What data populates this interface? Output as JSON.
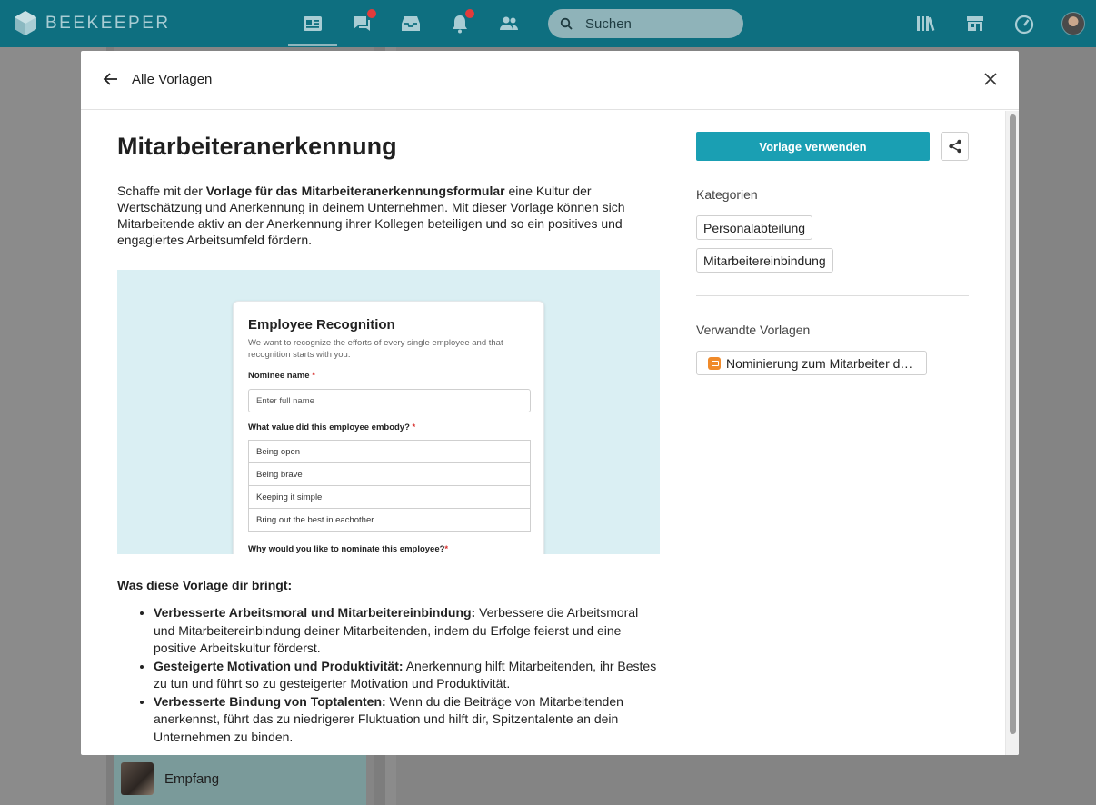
{
  "app": {
    "name": "BEEKEEPER"
  },
  "search": {
    "placeholder": "Suchen"
  },
  "sidebar_bg": {
    "item_label": "Empfang"
  },
  "modal": {
    "back_label": "Alle Vorlagen",
    "title": "Mitarbeiteranerkennung",
    "intro": {
      "before": "Schaffe mit der ",
      "bold": "Vorlage für das Mitarbeiteranerkennungsformular",
      "after": " eine Kultur der Wertschätzung und Anerkennung in deinem Unternehmen. Mit dieser Vorlage können sich Mitarbeitende aktiv an der Anerkennung ihrer Kollegen beteiligen und so ein positives und engagiertes Arbeitsumfeld fördern."
    },
    "preview": {
      "title": "Employee Recognition",
      "description": "We want to recognize the efforts of every single employee and that recognition starts with you.",
      "field1_label": "Nominee name",
      "field1_placeholder": "Enter full name",
      "field2_label": "What value did this employee embody?",
      "options": [
        "Being open",
        "Being brave",
        "Keeping it simple",
        "Bring out the best in eachother"
      ],
      "field3_label": "Why would you like to nominate this employee?",
      "required_mark": "*"
    },
    "benefits_heading": "Was diese Vorlage dir bringt:",
    "benefits": [
      {
        "title": "Verbesserte Arbeitsmoral und Mitarbeitereinbindung:",
        "text": " Verbessere die Arbeitsmoral und Mitarbeitereinbindung deiner Mitarbeitenden, indem du Erfolge feierst und eine positive Arbeitskultur förderst."
      },
      {
        "title": "Gesteigerte Motivation und Produktivität:",
        "text": " Anerkennung hilft Mitarbeitenden, ihr Bestes zu tun und führt so zu gesteigerter Motivation und Produktivität."
      },
      {
        "title": "Verbesserte Bindung von Toptalenten:",
        "text": " Wenn du die Beiträge von Mitarbeitenden anerkennst, führt das zu niedrigerer Fluktuation und hilft dir, Spitzentalente an dein Unternehmen zu binden."
      }
    ],
    "use_button": "Vorlage verwenden",
    "categories_label": "Kategorien",
    "categories": [
      "Personalabteilung",
      "Mitarbeitereinbindung"
    ],
    "related_label": "Verwandte Vorlagen",
    "related": [
      "Nominierung zum Mitarbeiter des Monats"
    ]
  },
  "colors": {
    "topbar": "#0e6f80",
    "accent": "#1a9fb3",
    "notification": "#e23b3b",
    "preview_bg": "#daeff3"
  }
}
